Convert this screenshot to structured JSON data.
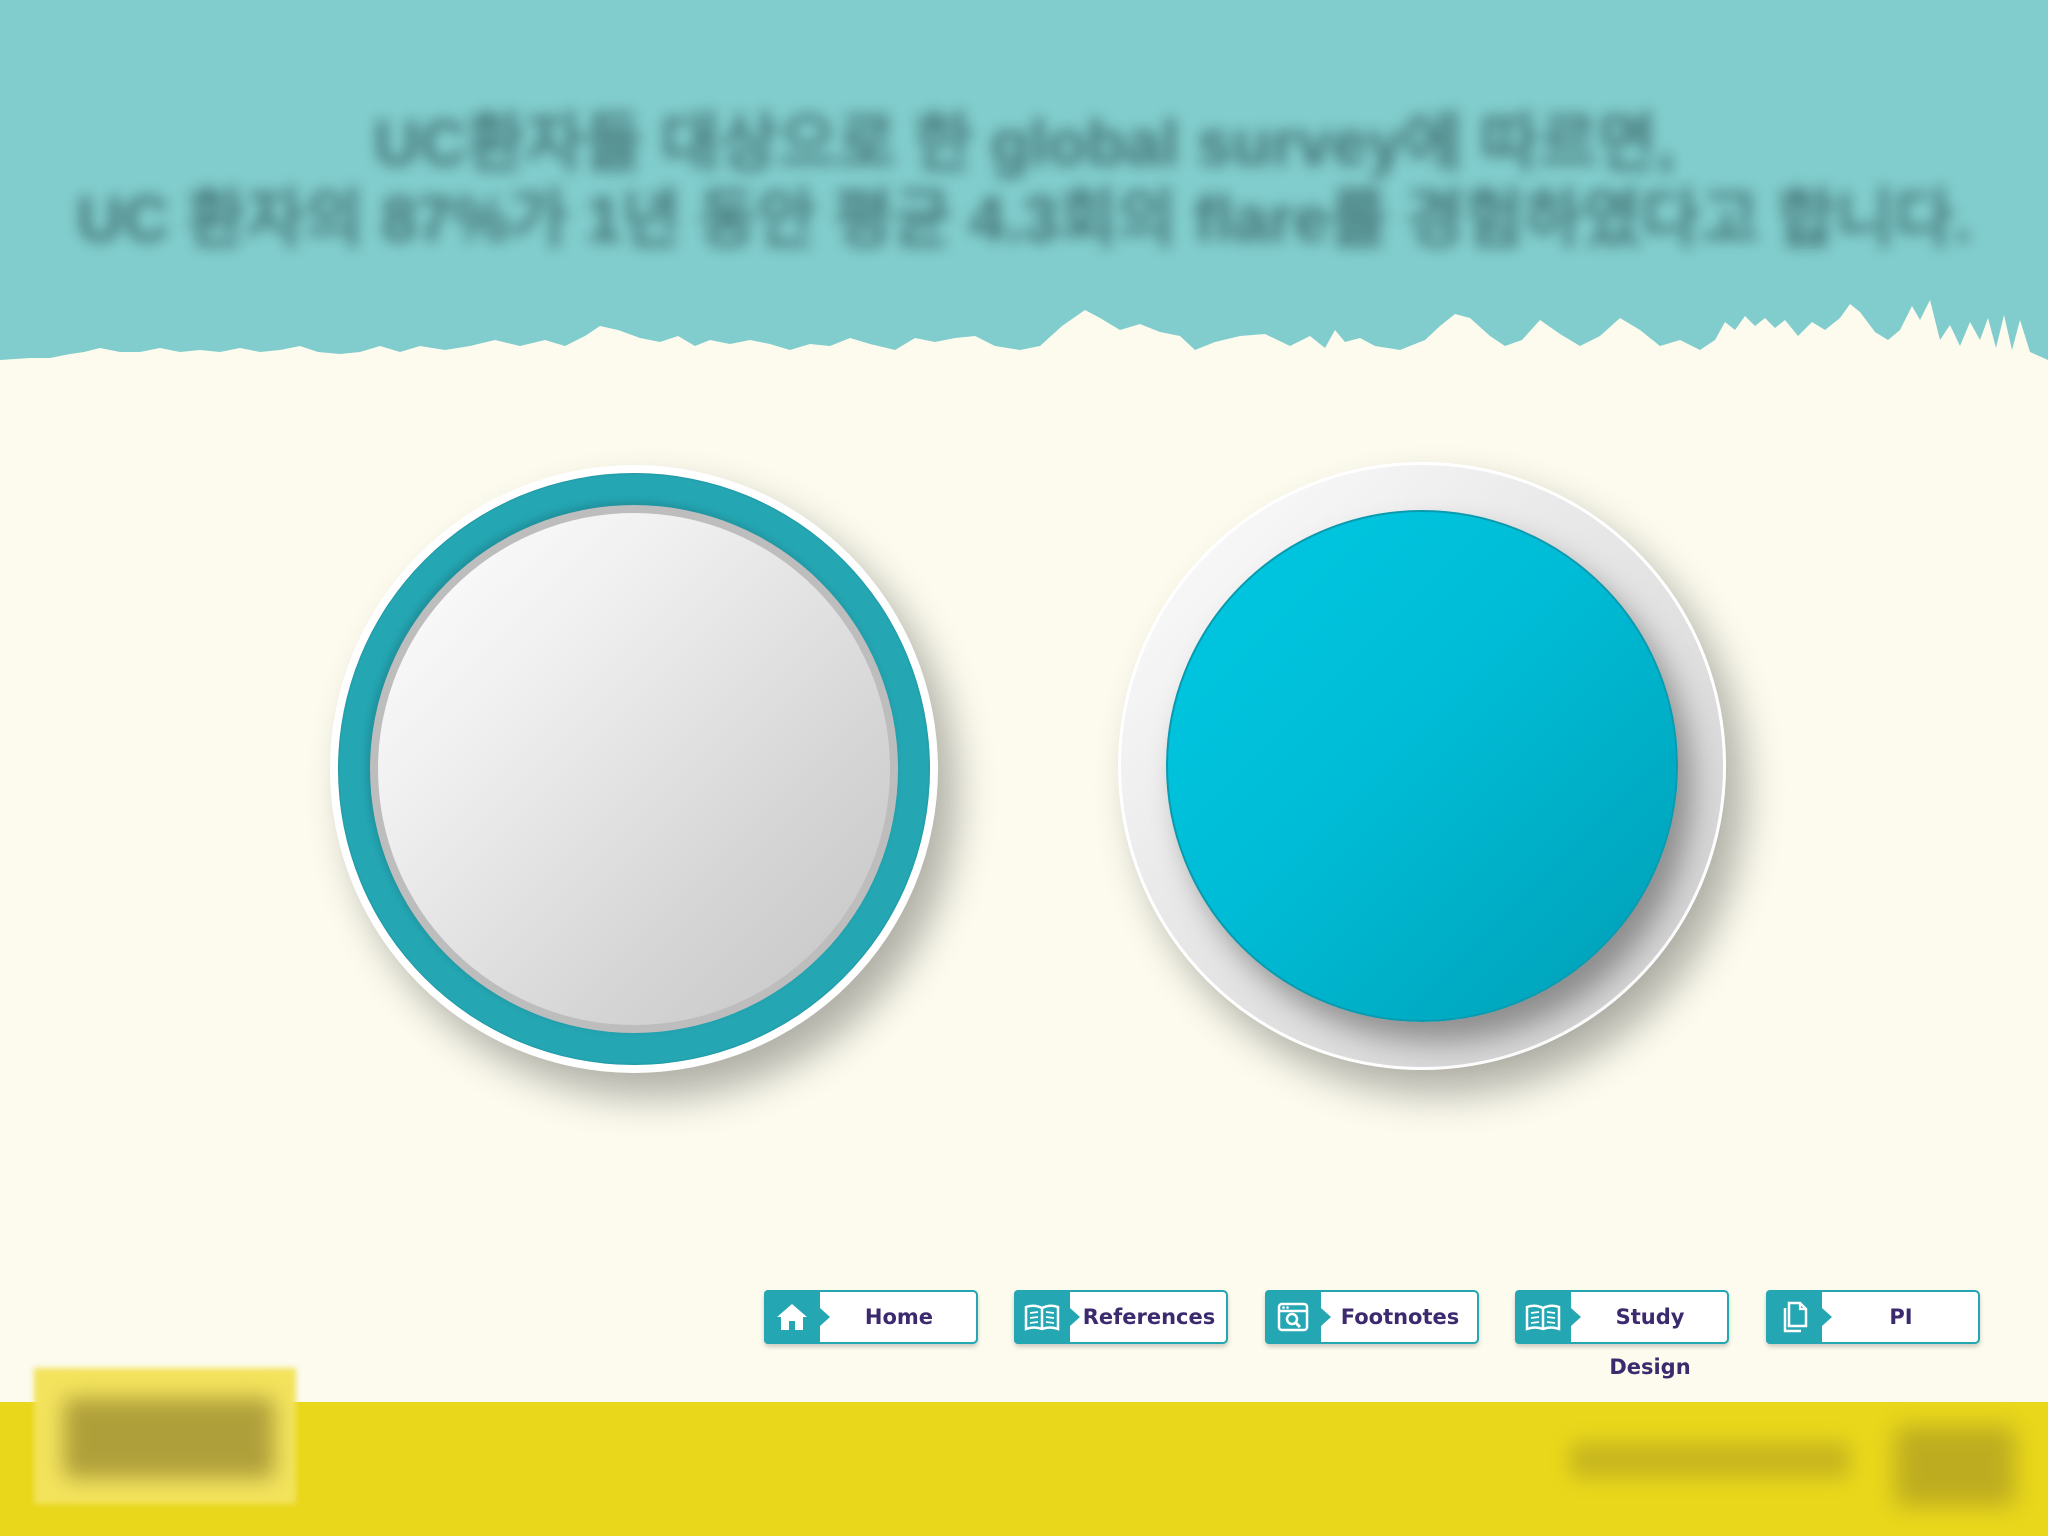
{
  "header": {
    "title_line1": "UC환자들 대상으로 한 global survey에 따르면,",
    "title_line2": "UC 환자의 87%가 1년 동안 평균 4.3회의 flare를 경험하였다고 합니다."
  },
  "circles": {
    "left_caption": "",
    "right_caption": ""
  },
  "nav": {
    "home": "Home",
    "references": "References",
    "footnotes": "Footnotes",
    "study_design": "Study Design",
    "pi": "PI"
  },
  "colors": {
    "header_bg": "#81cccc",
    "page_bg": "#fcfbee",
    "accent_teal": "#24a6b3",
    "cyan": "#00c2dc",
    "footer_bg": "#e9d71b",
    "nav_text": "#3b2a6e"
  },
  "icons": {
    "home": "home-icon",
    "references": "book-icon",
    "footnotes": "search-window-icon",
    "study_design": "book-icon",
    "pi": "document-copy-icon"
  }
}
